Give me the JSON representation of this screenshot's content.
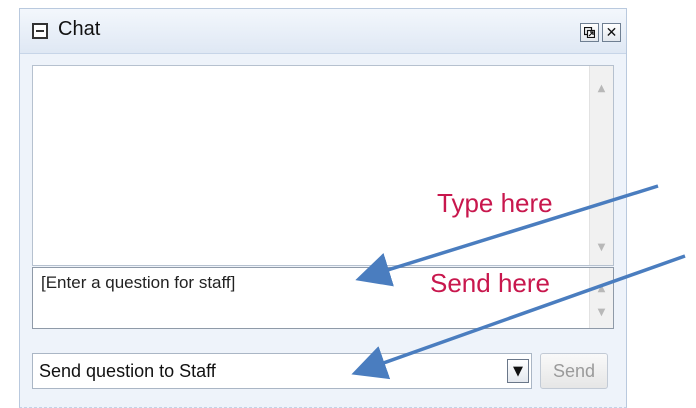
{
  "window": {
    "title": "Chat",
    "collapse_icon": "minus-box-icon",
    "popout_icon": "popout-icon",
    "close_icon": "close-icon"
  },
  "question_input": {
    "value": "[Enter a question for staff]"
  },
  "recipient_select": {
    "selected": "Send question to Staff"
  },
  "send_button": {
    "label": "Send",
    "state": "disabled"
  },
  "annotations": {
    "type_here": "Type here",
    "send_here": "Send here",
    "color": "#c8174d",
    "arrow_color": "#4a7dbf"
  },
  "colors": {
    "panel_bg": "#eef3fa",
    "panel_border": "#b9c9de",
    "titlebar_top": "#f3f7fc",
    "titlebar_bottom": "#dfe8f4"
  }
}
